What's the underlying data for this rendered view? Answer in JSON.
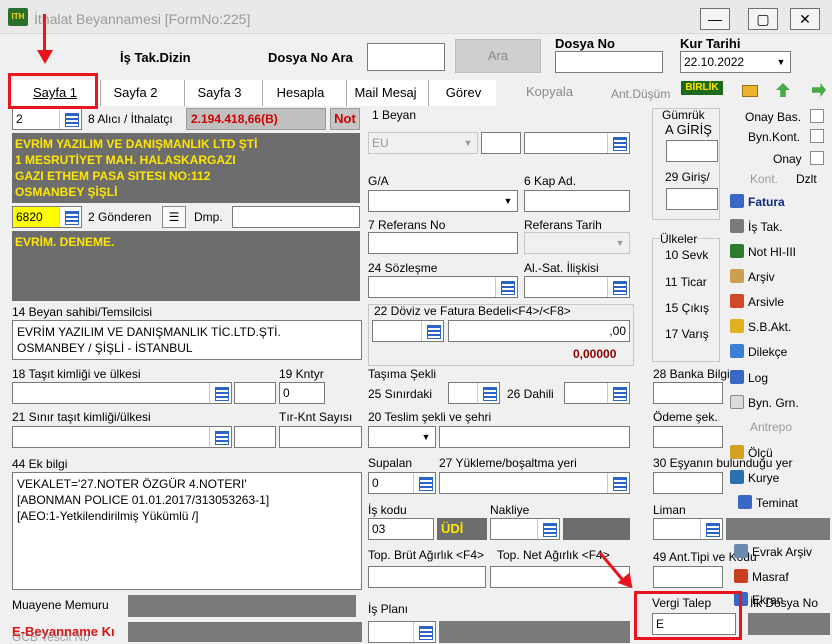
{
  "window": {
    "title": "İthalat Beyannamesi [FormNo:225]",
    "min": "—",
    "max": "▢",
    "close": "✕"
  },
  "header": {
    "is_takip_dizin": "İş Tak.Dizin",
    "dosya_no_ara_label": "Dosya No Ara",
    "ara_button": "Ara",
    "dosya_no_label": "Dosya No",
    "kur_tarihi_label": "Kur Tarihi",
    "kur_tarihi_value": "22.10.2022"
  },
  "tabs": [
    {
      "label": "Sayfa 1"
    },
    {
      "label": "Sayfa 2"
    },
    {
      "label": "Sayfa 3"
    },
    {
      "label": "Hesapla"
    },
    {
      "label": "Mail Mesaj"
    },
    {
      "label": "Görev"
    }
  ],
  "toolbar": {
    "kopyala": "Kopyala",
    "ant_dusum": "Ant.Düşüm",
    "birlik": "BİRLİK"
  },
  "left": {
    "alici_no": "2",
    "alici_label": "8 Alıcı / İthalatçı",
    "amount": "2.194.418,66(B)",
    "not_button": "Not",
    "alici_lines": [
      "EVRİM YAZILIM VE DANIŞMANLIK LTD ŞTİ",
      "1 MESRUTİYET MAH. HALASKARGAZI",
      "GAZI ETHEM PASA SITESI NO:112",
      "OSMANBEY ŞİŞLİ"
    ],
    "gonderen_no": "6820",
    "gonderen_label": "2 Gönderen",
    "dmp_label": "Dmp.",
    "gonderen_lines": [
      "EVRİM. DENEME."
    ],
    "beyan_sahibi_label": "14 Beyan sahibi/Temsilcisi",
    "beyan_sahibi_lines": [
      "EVRİM YAZILIM VE DANIŞMANLIK TİC.LTD.ŞTİ.",
      "OSMANBEY / ŞİŞLİ - İSTANBUL"
    ],
    "tasit_label": "18 Taşıt kimliği ve ülkesi",
    "kntyr_label": "19 Kntyr",
    "kntyr_value": "0",
    "sinir_tasit_label": "21 Sınır taşıt kimliği/ülkesi",
    "tir_label": "Tır-Knt Sayısı",
    "ek_bilgi_label": "44 Ek bilgi",
    "ek_bilgi_lines": [
      "VEKALET='27.NOTER ÖZGÜR 4.NOTERI'",
      "[ABONMAN POLICE 01.01.2017/313053263-1]",
      "[AEO:1-Yetkilendirilmiş Yükümlü /]"
    ],
    "muayene_label": "Muayene Memuru",
    "e_beyanname_label": "E-Beyanname Kı",
    "gcb_label": "GCB Tescil No"
  },
  "middle": {
    "beyan_label": "1 Beyan",
    "beyan_value": "EU",
    "ga_label": "G/A",
    "kap_label": "6 Kap Ad.",
    "ref_no_label": "7 Referans No",
    "ref_tarih_label": "Referans Tarih",
    "sozlesme_label": "24 Sözleşme",
    "al_sat_label": "Al.-Sat. İlişkisi",
    "doviz_label": "22 Döviz ve Fatura Bedeli<F4>/<F8>",
    "doviz_value": ",00",
    "doviz_total": "0,00000",
    "tasima_label": "Taşıma Şekli",
    "sinirdaki_label": "25 Sınırdaki",
    "dahili_label": "26 Dahili",
    "teslim_label": "20 Teslim şekli ve şehri",
    "supalan_label": "Supalan",
    "supalan_value": "0",
    "yukleme_label": "27 Yükleme/boşaltma yeri",
    "is_kodu_label": "İş kodu",
    "is_kodu_value": "03",
    "udi_value": "ÜDİ",
    "nakliye_label": "Nakliye",
    "brut_label": "Top. Brüt Ağırlık <F4>",
    "net_label": "Top. Net Ağırlık <F4>",
    "is_plani_label": "İş Planı"
  },
  "right": {
    "gumruk_label": "Gümrük",
    "a_giris_label": "A GİRİŞ",
    "giris_label": "29 Giriş/",
    "ulkeler_label": "Ülkeler",
    "sevk_label": "10 Sevk",
    "ticar_label": "11 Ticar",
    "cikis_label": "15 Çıkış",
    "varis_label": "17 Varış",
    "banka_label": "28 Banka Bilgi",
    "odeme_label": "Ödeme şek.",
    "esya_label": "30 Eşyanın bulunduğu yer",
    "liman_label": "Liman",
    "ant_tipi_label": "49 Ant.Tipi ve Kodu",
    "vergi_talep_label": "Vergi Talep",
    "vergi_talep_value": "E",
    "ilk_dosya_label": "İlk Dosya No"
  },
  "side_panel": {
    "onay_bas": "Onay Bas.",
    "byn_kont": "Byn.Kont.",
    "onay": "Onay",
    "kont": "Kont.",
    "dzlt": "Dzlt",
    "items": [
      {
        "label": "Fatura"
      },
      {
        "label": "İş Tak."
      },
      {
        "label": "Not HI-III"
      },
      {
        "label": "Arşiv"
      },
      {
        "label": "Arsivle"
      },
      {
        "label": "S.B.Akt."
      },
      {
        "label": "Dilekçe"
      },
      {
        "label": "Log"
      },
      {
        "label": "Byn. Grn."
      },
      {
        "label": "Antrepo"
      },
      {
        "label": "Ölçü"
      },
      {
        "label": "Kurye"
      },
      {
        "label": "Teminat"
      },
      {
        "label": "Evrak Arşiv"
      },
      {
        "label": "Masraf"
      },
      {
        "label": "Ekran"
      }
    ]
  }
}
